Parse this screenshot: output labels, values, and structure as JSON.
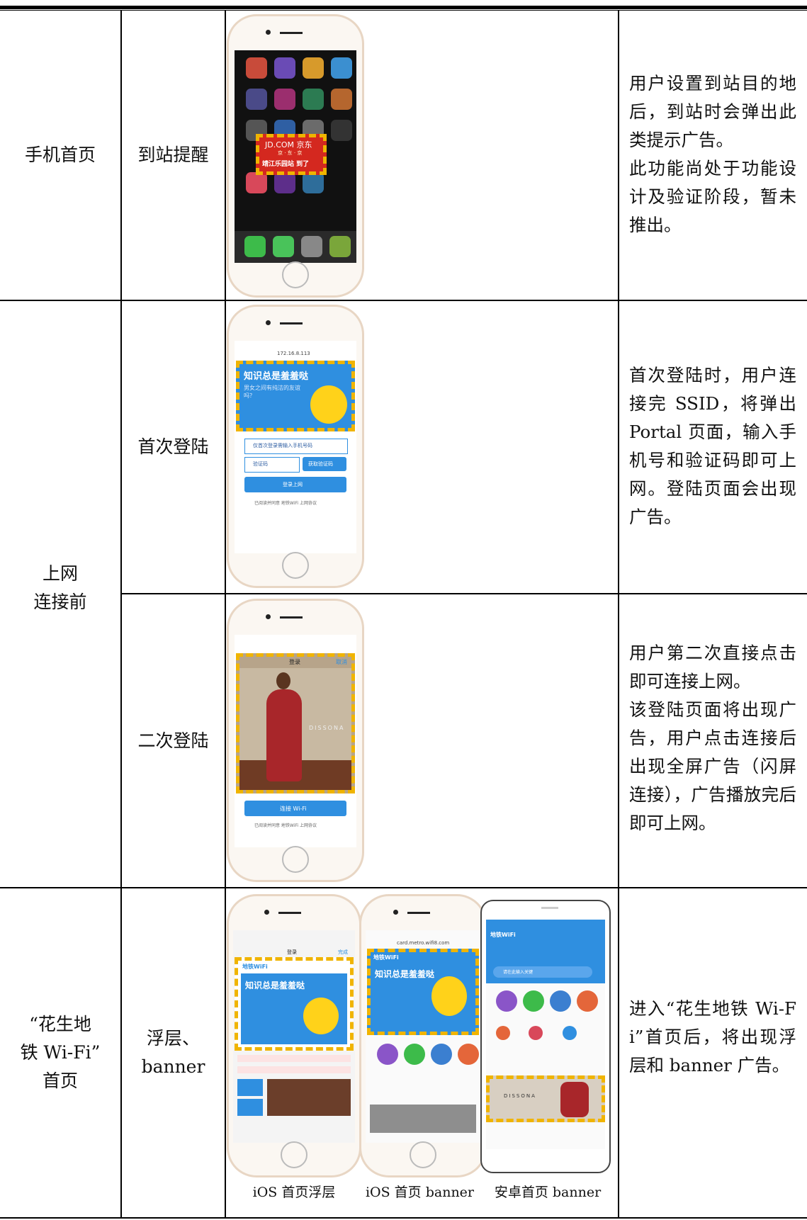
{
  "rows": [
    {
      "category": "手机首页",
      "feature": "到站提醒",
      "description": [
        "用户设置到站目的地后，到站时会弹出此类提示广告。",
        "此功能尚处于功能设计及验证阶段，暂未推出。"
      ],
      "screen_text": {
        "brand": "JD.COM 京东",
        "promo": "京 · 东 · 京",
        "alert": "靖江乐园站 到了"
      }
    },
    {
      "category": "上网\n连接前",
      "items": [
        {
          "feature": "首次登陆",
          "description": [
            "首次登陆时，用户连接完 SSID，将弹出 Portal 页面，输入手机号和验证码即可上网。登陆页面会出现广告。"
          ],
          "screen_text": {
            "url": "172.16.8.113",
            "ad_title": "知识总是羞羞哒",
            "ad_sub": "男女之间有纯洁的友谊吗？",
            "phone_placeholder": "仅首次登录需输入手机号码",
            "code_placeholder": "验证码",
            "code_button": "获取验证码",
            "login_button": "登录上网",
            "agree": "已阅读并同意 地铁WiFi 上网协议"
          }
        },
        {
          "feature": "二次登陆",
          "description": [
            "用户第二次直接点击即可连接上网。",
            "该登陆页面将出现广告，用户点击连接后出现全屏广告（闪屏连接），广告播放完后即可上网。"
          ],
          "screen_text": {
            "nav_title": "登录",
            "nav_cancel": "取消",
            "brand": "DISSONA",
            "connect_button": "连接 Wi-Fi",
            "agree": "已阅读并同意 地铁WiFi 上网协议"
          }
        }
      ]
    },
    {
      "category": "“花生地\n铁 Wi-Fi”\n首页",
      "feature": "浮层、\nbanner",
      "description": [
        "进入“花生地铁 Wi-Fi”首页后，将出现浮层和 banner 广告。"
      ],
      "captions": [
        "iOS 首页浮层",
        "iOS 首页 banner",
        "安卓首页 banner"
      ],
      "screen_text": {
        "app_name": "地铁WiFi",
        "ad_title": "知识总是羞羞哒",
        "url": "card.metro.wifi8.com",
        "nav_title": "登录",
        "nav_done": "完成",
        "search_placeholder": "请在此输入关键",
        "brand": "DISSONA"
      }
    }
  ],
  "colors": {
    "ad_blue": "#2f8fe0",
    "dash_yellow": "#f0b400",
    "phone_frame": "#e8d6c4",
    "dress_red": "#a8262a"
  }
}
